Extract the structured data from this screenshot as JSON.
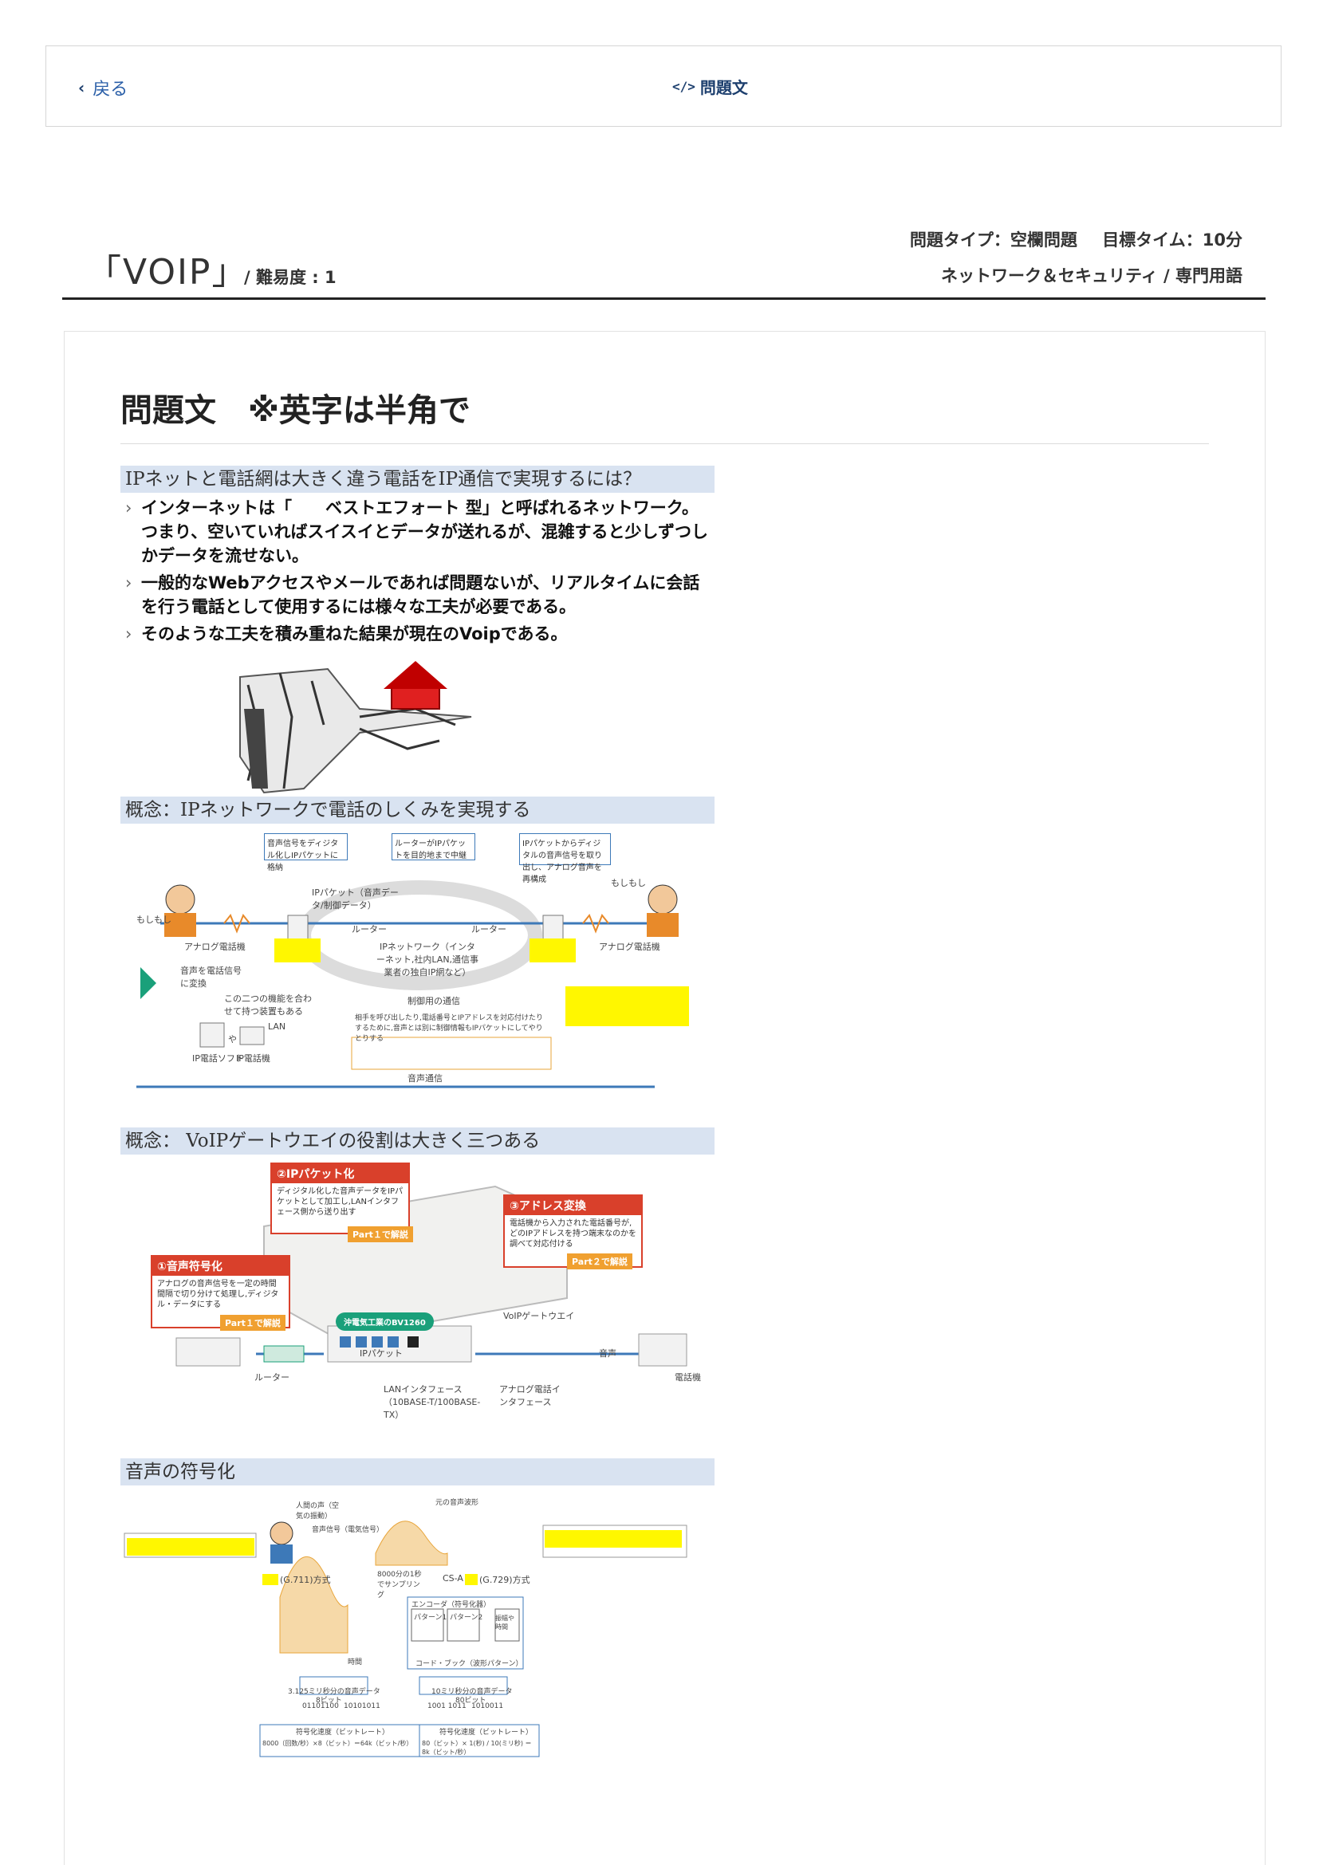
{
  "nav": {
    "back_label": "戻る",
    "tab_label": "問題文"
  },
  "header": {
    "title": "「VOIP」",
    "difficulty": "/ 難易度 : 1",
    "question_type": "問題タイプ：空欄問題",
    "target_time": "目標タイム：10分",
    "category": "ネットワーク＆セキュリティ / 専門用語"
  },
  "question": {
    "heading": "問題文　※英字は半角で"
  },
  "slide1": {
    "title": "IPネットと電話網は大きく違う電話をIP通信で実現するには？",
    "bullets": [
      "インターネットは「　　ベストエフォート 型」と呼ばれるネットワーク。つまり、空いていればスイスイとデータが送れるが、混雑すると少しずつしかデータを流せない。",
      "一般的なWebアクセスやメールであれば問題ないが、リアルタイムに会話を行う電話として使用するには様々な工夫が必要である。",
      "そのような工夫を積み重ねた結果が現在のVoipである。"
    ]
  },
  "slide2": {
    "title": "概念：IPネットワークで電話のしくみを実現する",
    "step3": "音声信号をディジタル化しIPパケットに格納",
    "step_router": "ルーターがIPパケットを目的地まで中継",
    "step4": "IPパケットからディジタルの音声信号を取り出し、アナログ音声を再構成",
    "moshimoshi_left": "もしもし",
    "moshimoshi_right": "もしもし",
    "analog_left": "アナログ電話機",
    "analog_right": "アナログ電話機",
    "ip_packet": "IPパケット（音声データ/制御データ）",
    "router1": "ルーター",
    "router2": "ルーター",
    "ip_network": "IPネットワーク（インターネット,社内LAN,通信事業者の独自IP網など）",
    "step1": "音声を電話信号に変換",
    "combine": "この二つの機能を合わせて持つ装置もある",
    "control": "制御用の通信",
    "control_note": "相手を呼び出したり,電話番号とIPアドレスを対応付けたりするために,音声とは別に制御情報もIPパケットにしてやりとりする",
    "lan": "LAN",
    "softphone": "IP電話ソフト",
    "ipphone": "IP電話機",
    "or": "や",
    "voice_comm": "音声通信"
  },
  "slide3": {
    "title": "概念： VoIPゲートウエイの役割は大きく三つある",
    "r2_head": "②IPパケット化",
    "r2_body": "ディジタル化した音声データをIPパケットとして加工し,LANインタフェース側から送り出す",
    "r2_tag": "Part１で解説",
    "r3_head": "③アドレス変換",
    "r3_body": "電話機から入力された電話番号が,どのIPアドレスを持つ端末なのかを調べて対応付ける",
    "r3_tag": "Part２で解説",
    "r1_head": "①音声符号化",
    "r1_body": "アナログの音声信号を一定の時間間隔で切り分けて処理し,ディジタル・データにする",
    "r1_tag": "Part１で解説",
    "device": "沖電気工業のBV1260",
    "gateway": "VoIPゲートウエイ",
    "ippacket": "IPパケット",
    "router": "ルーター",
    "voice": "音声",
    "phone": "電話機",
    "lan_if": "LANインタフェース（10BASE-T/100BASE-TX）",
    "analog_if": "アナログ電話インタフェース"
  },
  "slide4": {
    "title": "音声の符号化",
    "g711": "(G.711)方式",
    "cs": "CS-A",
    "g729": "(G.729)方式",
    "voice_origin": "人間の声（空気の振動）",
    "voice_signal": "音声信号（電気信号）",
    "wave": "元の音声波形",
    "sampling": "8000分の1秒でサンプリング",
    "encoder": "エンコーダ（符号化器）",
    "codebook": "コード・ブック（波形パターン）",
    "pattern1": "パターン1",
    "pattern2": "パターン2",
    "amplitude": "振幅や時間",
    "data1": "3.125ミリ秒分の音声データ",
    "data2": "10ミリ秒分の音声データ",
    "bits1": "8ビット",
    "bits2": "80ビット",
    "code1": "01101100",
    "code2": "10101011",
    "code3": "1001 1011",
    "code4": "1010011",
    "rate_label": "符号化速度（ビットレート）",
    "rate1": "8000（回数/秒）×8（ビット）＝64k（ビット/秒）",
    "rate2": "80（ビット）× 1(秒) / 10(ミリ秒) ＝ 8k（ビット/秒）",
    "time": "時間"
  },
  "colors": {
    "band": "#d9e3f1",
    "highlight": "#fff700",
    "accent": "#1d3f6e",
    "red": "#d9402b"
  }
}
